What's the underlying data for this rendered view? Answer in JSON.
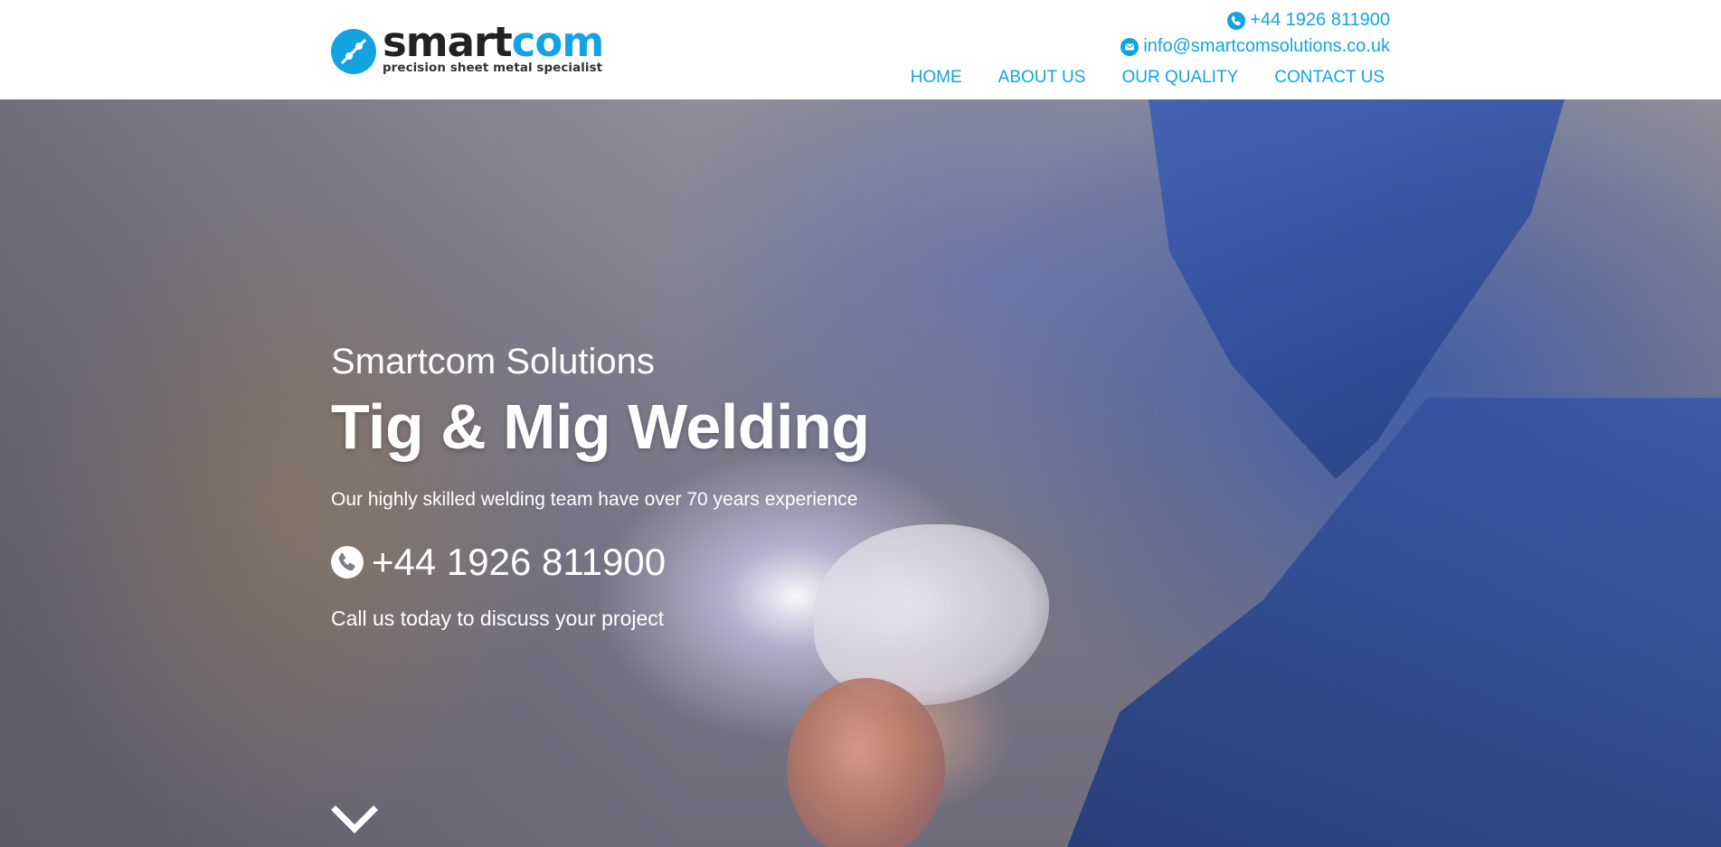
{
  "brand": {
    "name_dark": "smart",
    "name_blue": "com",
    "tagline": "precision sheet metal specialist",
    "logo_icon": "logo-mark-icon",
    "accent_color": "#13a3e2"
  },
  "header": {
    "phone": "+44 1926 811900",
    "phone_icon": "phone-icon",
    "email": "info@smartcomsolutions.co.uk",
    "email_icon": "envelope-icon"
  },
  "nav": {
    "items": [
      {
        "label": "HOME"
      },
      {
        "label": "ABOUT US"
      },
      {
        "label": "OUR QUALITY"
      },
      {
        "label": "CONTACT US"
      }
    ]
  },
  "hero": {
    "subtitle": "Smartcom Solutions",
    "title": "Tig & Mig Welding",
    "text": "Our highly skilled welding team have over 70 years experience",
    "phone": "+44 1926 811900",
    "phone_icon": "phone-icon",
    "cta": "Call us today to discuss your project",
    "scroll_icon": "chevron-down-icon"
  }
}
